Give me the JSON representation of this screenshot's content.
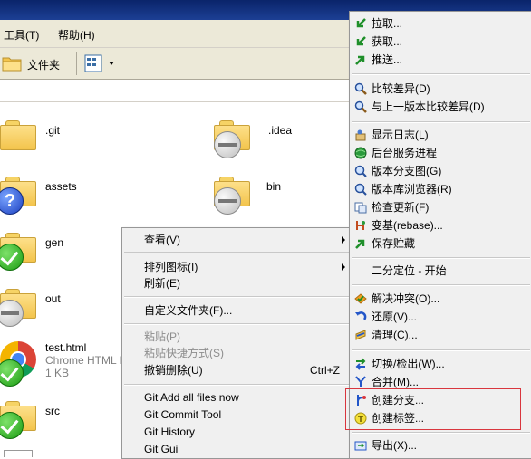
{
  "menubar": {
    "tools": "工具(T)",
    "help": "帮助(H)"
  },
  "toolbar": {
    "folders": "文件夹"
  },
  "files": [
    {
      "name": ".git",
      "icon": "folder-icon",
      "overlay": "none"
    },
    {
      "name": ".idea",
      "icon": "folder-icon",
      "overlay": "unversioned"
    },
    {
      "name": "assets",
      "icon": "folder-icon",
      "overlay": "added"
    },
    {
      "name": "bin",
      "icon": "folder-icon",
      "overlay": "unversioned"
    },
    {
      "name": "gen",
      "icon": "folder-icon",
      "overlay": "normal"
    },
    {
      "name": "out",
      "icon": "folder-icon",
      "overlay": "unversioned"
    },
    {
      "name": "test.html",
      "type": "Chrome HTML D",
      "size": "1 KB",
      "icon": "chrome-html-icon",
      "overlay": "normal"
    },
    {
      "name": "src",
      "icon": "folder-icon",
      "overlay": "normal"
    }
  ],
  "context_menu": {
    "view": "查看(V)",
    "arrange": "排列图标(I)",
    "refresh": "刷新(E)",
    "customize": "自定义文件夹(F)...",
    "paste": "粘贴(P)",
    "paste_shortcut": "粘贴快捷方式(S)",
    "undo_delete": "撤销删除(U)",
    "undo_shortcut": "Ctrl+Z",
    "git_add_all": "Git Add all files now",
    "git_commit": "Git Commit Tool",
    "git_history": "Git History",
    "git_gui": "Git Gui"
  },
  "tortoise_menu": {
    "pull": "拉取...",
    "fetch": "获取...",
    "push": "推送...",
    "diff": "比较差异(D)",
    "diff_prev": "与上一版本比较差异(D)",
    "show_log": "显示日志(L)",
    "daemon": "后台服务进程",
    "revision_graph": "版本分支图(G)",
    "repo_browser": "版本库浏览器(R)",
    "check_mods": "检查更新(F)",
    "rebase": "变基(rebase)...",
    "stash": "保存贮藏",
    "bisect": "二分定位 - 开始",
    "resolve": "解决冲突(O)...",
    "revert": "还原(V)...",
    "cleanup": "清理(C)...",
    "switch": "切换/检出(W)...",
    "merge": "合并(M)...",
    "create_branch": "创建分支...",
    "create_tag": "创建标签...",
    "export": "导出(X)..."
  },
  "colors": {
    "highlight_border": "#d9363e",
    "titlebar": "#0a246a"
  }
}
